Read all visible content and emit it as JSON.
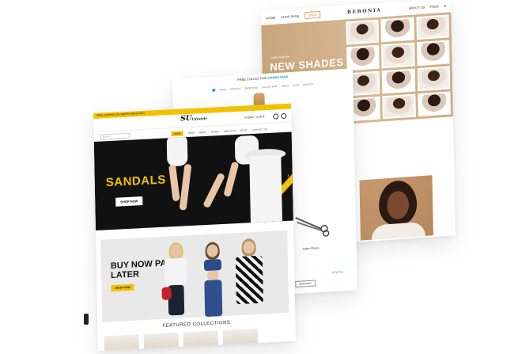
{
  "back_site": {
    "brand": "BEBONIA",
    "nav_left": [
      "HOME",
      "SHOP PAGE",
      "SHOP"
    ],
    "nav_right": [
      "ABOUT US",
      "FAQS"
    ],
    "hero_tag": "NEW ARRIVAL",
    "hero_heading": "NEW SHADES",
    "grid_tiles": 12
  },
  "mid_site": {
    "promo": "FREE COLLECTION",
    "promo_highlight": "ORDER NOW",
    "nav": [
      "HOME",
      "PRODUCT",
      "SHOP PAGE",
      "COLLECTIONS",
      "ABOUT",
      "BLOG",
      "CONTACT"
    ],
    "product_label": "Salon Shears",
    "link": "VIEW ALL",
    "button": "DISCOUNT"
  },
  "front_site": {
    "top_bar": "FREE SHIPPING ON ORDERS ABOVE $100",
    "logo": "SU",
    "logo_suffix": "Lifestyle",
    "language": "English • USD $",
    "search_placeholder": "Search",
    "menu": [
      "HOME",
      "SHOP",
      "BAGS",
      "SHOES",
      "ABOUT US",
      "BLOG",
      "CONTACT US"
    ],
    "hero_title": "SANDALS",
    "hero_button": "SHOP NOW",
    "hero_arrow": "›",
    "promo_title": "BUY NOW PAY LATER",
    "promo_button": "SHOP NOW",
    "featured_heading": "FEATURED COLLECTIONS"
  },
  "colors": {
    "accent_yellow": "#f2c200",
    "teal": "#1aa7b6",
    "bebonia_tan": "#c9a57c",
    "hero_dark": "#111111"
  }
}
